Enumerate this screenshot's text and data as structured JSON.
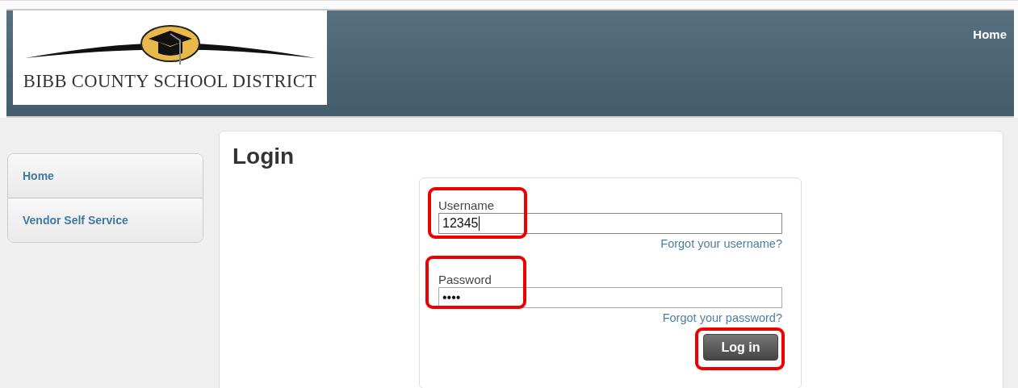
{
  "header": {
    "logo_text": "BIBB COUNTY SCHOOL DISTRICT",
    "nav": [
      {
        "label": "Home"
      }
    ]
  },
  "sidebar": {
    "items": [
      {
        "label": "Home"
      },
      {
        "label": "Vendor Self Service"
      }
    ]
  },
  "login": {
    "title": "Login",
    "fields": [
      {
        "label": "Username",
        "value": "12345",
        "focused": true,
        "highlighted": true,
        "link": "Forgot your username?"
      },
      {
        "label": "Password",
        "value": "••••",
        "focused": false,
        "highlighted": true,
        "link": "Forgot your password?"
      }
    ],
    "button": {
      "label": "Log in",
      "highlighted": true
    }
  }
}
